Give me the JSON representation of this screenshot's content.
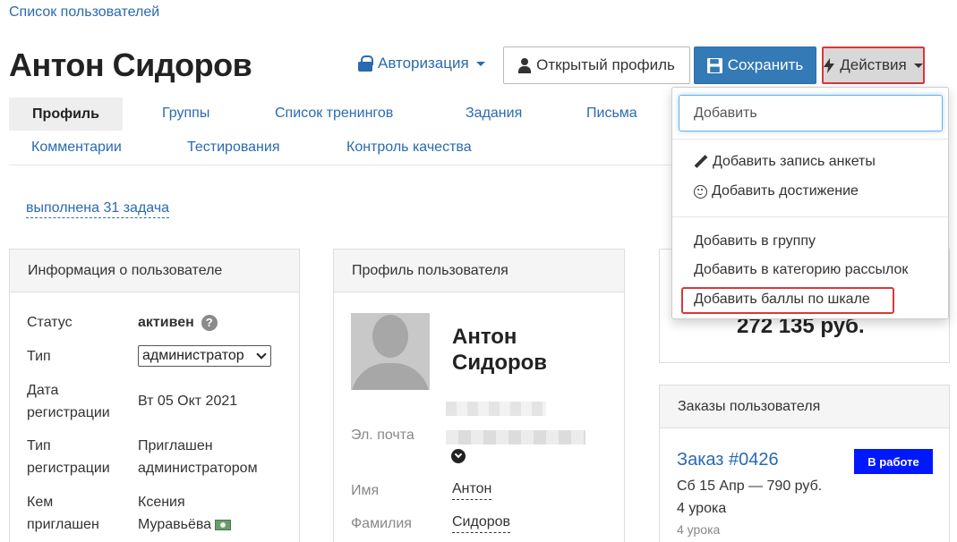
{
  "breadcrumb": "Список пользователей",
  "user_name": "Антон Сидоров",
  "header": {
    "auth_label": "Авторизация",
    "open_profile_label": "Открытый профиль",
    "save_label": "Сохранить",
    "actions_label": "Действия"
  },
  "tabs": [
    "Профиль",
    "Группы",
    "Список тренингов",
    "Задания",
    "Письма",
    "Комментарии",
    "Тестирования",
    "Контроль качества"
  ],
  "tasks_link": "выполнена 31 задача",
  "info_panel": {
    "title": "Информация о пользователе",
    "status_label": "Статус",
    "status_value": "активен",
    "type_label": "Тип",
    "type_value": "администратор",
    "reg_date_label_1": "Дата",
    "reg_date_label_2": "регистрации",
    "reg_date_value": "Вт 05 Окт 2021",
    "reg_type_label_1": "Тип",
    "reg_type_label_2": "регистрации",
    "reg_type_value_1": "Приглашен",
    "reg_type_value_2": "администратором",
    "invited_label_1": "Кем",
    "invited_label_2": "приглашен",
    "invited_value_1": "Ксения",
    "invited_value_2": "Муравьёва"
  },
  "profile_panel": {
    "title": "Профиль пользователя",
    "name_line1": "Антон",
    "name_line2": "Сидоров",
    "email_label": "Эл. почта",
    "first_name_label": "Имя",
    "first_name_value": "Антон",
    "last_name_label": "Фамилия",
    "last_name_value": "Сидоров"
  },
  "sum_panel": {
    "amount": "272 135 руб."
  },
  "orders_panel": {
    "title": "Заказы пользователя",
    "order_link": "Заказ #0426",
    "status": "В работе",
    "line1": "Сб 15 Апр — 790 руб.",
    "line2": "4 урока",
    "line3": "4 урока"
  },
  "dropdown": {
    "input_placeholder": "Добавить",
    "items": [
      "Добавить запись анкеты",
      "Добавить достижение",
      "Добавить в группу",
      "Добавить в категорию рассылок",
      "Добавить баллы по шкале"
    ]
  },
  "colors": {
    "accent": "#337ab7",
    "link": "#2a6ab0",
    "highlight": "#d9383a",
    "badge": "#0018ff"
  }
}
